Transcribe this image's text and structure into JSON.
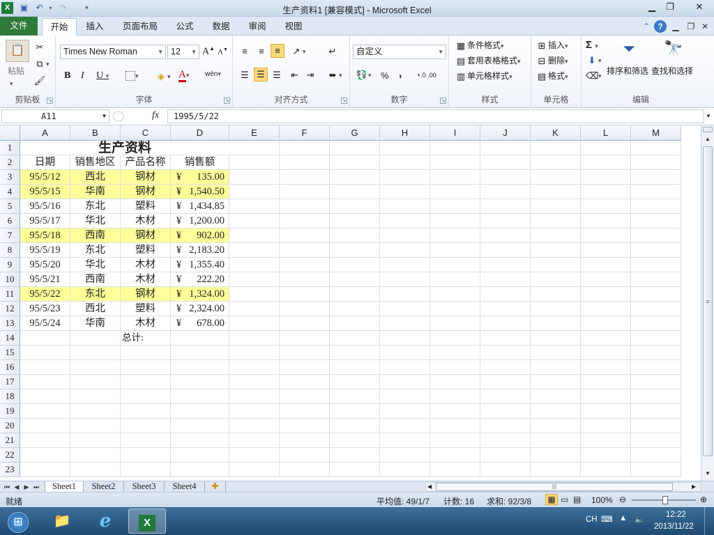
{
  "window": {
    "title": "生产资料1 [兼容模式] - Microsoft Excel",
    "app_icon": "excel-icon"
  },
  "ribbon_tabs": [
    "文件",
    "开始",
    "插入",
    "页面布局",
    "公式",
    "数据",
    "审阅",
    "视图"
  ],
  "ribbon": {
    "clipboard": {
      "paste": "粘贴",
      "label": "剪贴板"
    },
    "font": {
      "name": "Times New Roman",
      "size": "12",
      "label": "字体",
      "bold": "B",
      "italic": "I",
      "underline": "U",
      "grow": "A",
      "shrink": "A",
      "wen": "wén"
    },
    "alignment": {
      "label": "对齐方式"
    },
    "number": {
      "format": "自定义",
      "label": "数字",
      "percent": "%",
      "comma": ",",
      "inc_dec": "+.0 .00",
      "dec_dec": ".00 →.0"
    },
    "styles": {
      "conditional": "条件格式",
      "table": "套用表格格式",
      "cell": "单元格样式",
      "label": "样式"
    },
    "cells": {
      "insert": "插入",
      "delete": "删除",
      "format": "格式",
      "label": "单元格"
    },
    "editing": {
      "sort": "排序和筛选",
      "find": "查找和选择",
      "label": "编辑",
      "sigma": "Σ"
    }
  },
  "formula_bar": {
    "name_box": "A11",
    "fx": "fx",
    "formula": "1995/5/22"
  },
  "columns": [
    "A",
    "B",
    "C",
    "D",
    "E",
    "F",
    "G",
    "H",
    "I",
    "J",
    "K",
    "L",
    "M"
  ],
  "rows": [
    "1",
    "2",
    "3",
    "4",
    "5",
    "6",
    "7",
    "8",
    "9",
    "10",
    "11",
    "12",
    "13",
    "14",
    "15",
    "16",
    "17",
    "18",
    "19",
    "20",
    "21",
    "22",
    "23"
  ],
  "sheet": {
    "title": "生产资料",
    "headers": [
      "日期",
      "销售地区",
      "产品名称",
      "销售额"
    ],
    "currency": "¥",
    "records": [
      {
        "date": "95/5/12",
        "region": "西北",
        "product": "钢材",
        "amount": "135.00",
        "highlight": true
      },
      {
        "date": "95/5/15",
        "region": "华南",
        "product": "钢材",
        "amount": "1,540.50",
        "highlight": true
      },
      {
        "date": "95/5/16",
        "region": "东北",
        "product": "塑料",
        "amount": "1,434.85",
        "highlight": false
      },
      {
        "date": "95/5/17",
        "region": "华北",
        "product": "木材",
        "amount": "1,200.00",
        "highlight": false
      },
      {
        "date": "95/5/18",
        "region": "西南",
        "product": "钢材",
        "amount": "902.00",
        "highlight": true
      },
      {
        "date": "95/5/19",
        "region": "东北",
        "product": "塑料",
        "amount": "2,183.20",
        "highlight": false
      },
      {
        "date": "95/5/20",
        "region": "华北",
        "product": "木材",
        "amount": "1,355.40",
        "highlight": false
      },
      {
        "date": "95/5/21",
        "region": "西南",
        "product": "木材",
        "amount": "222.20",
        "highlight": false
      },
      {
        "date": "95/5/22",
        "region": "东北",
        "product": "钢材",
        "amount": "1,324.00",
        "highlight": true
      },
      {
        "date": "95/5/23",
        "region": "西北",
        "product": "塑料",
        "amount": "2,324.00",
        "highlight": false
      },
      {
        "date": "95/5/24",
        "region": "华南",
        "product": "木材",
        "amount": "678.00",
        "highlight": false
      }
    ],
    "total_label": "总计:"
  },
  "sheet_tabs": [
    "Sheet1",
    "Sheet2",
    "Sheet3",
    "Sheet4"
  ],
  "status_bar": {
    "ready": "就绪",
    "average": "平均值: 49/1/7",
    "count": "计数: 16",
    "sum": "求和: 92/3/8",
    "zoom": "100%"
  },
  "taskbar": {
    "lang": "CH",
    "time": "12:22",
    "date": "2013/11/22"
  },
  "colors": {
    "highlight": "#ffff99",
    "file_tab": "#2f7b3a"
  }
}
